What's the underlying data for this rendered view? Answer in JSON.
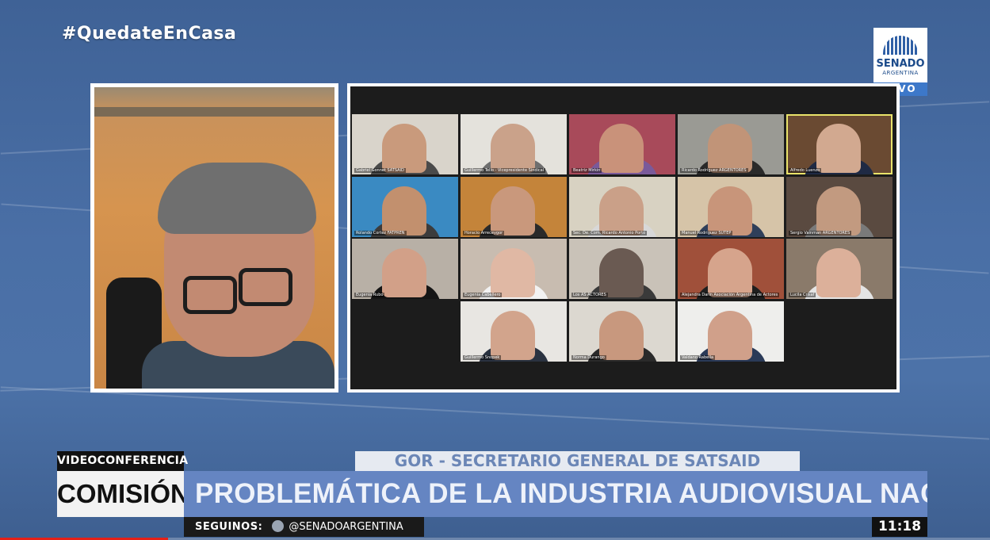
{
  "hashtag": "#QuedateEnCasa",
  "logo": {
    "name": "SENADO",
    "country": "ARGENTINA",
    "live": "VIVO"
  },
  "speaker": {
    "label": "active speaker video"
  },
  "gallery": {
    "participants": [
      {
        "name": "Gabriel Gonnet SATSAID",
        "skin": "#c99a7c",
        "bg": "#d9d4cb",
        "shirt": "#4a4a4a",
        "active": false
      },
      {
        "name": "Guillermo Tello - Vicepresidente Sindical",
        "skin": "#caa28a",
        "bg": "#e4e2dc",
        "shirt": "#6e6e6e",
        "active": false
      },
      {
        "name": "Beatriz Mirkin",
        "skin": "#c9927a",
        "bg": "#a84a5a",
        "shirt": "#7a5a9a",
        "active": false
      },
      {
        "name": "Ricardo Rodríguez ARGENTORES",
        "skin": "#c19478",
        "bg": "#9a9a94",
        "shirt": "#2a2a2a",
        "active": false
      },
      {
        "name": "Alfredo Luenzo",
        "skin": "#d2a990",
        "bg": "#6a4a32",
        "shirt": "#1f2a44",
        "active": true
      },
      {
        "name": "Rolando Cortez FATPREN",
        "skin": "#c2906e",
        "bg": "#3a8ac2",
        "shirt": "#3c3c3c",
        "active": false
      },
      {
        "name": "Horacio Arreceygor",
        "skin": "#c9987c",
        "bg": "#c4843a",
        "shirt": "#2a2a2a",
        "active": false
      },
      {
        "name": "Sec. De. Com. Ricardo Antonio Porto",
        "skin": "#caa088",
        "bg": "#d8d2c2",
        "shirt": "#d8d8d8",
        "active": false
      },
      {
        "name": "Manuel Rodríguez SUTEP",
        "skin": "#c8957a",
        "bg": "#d6c4a8",
        "shirt": "#2f3f5a",
        "active": false
      },
      {
        "name": "Sergio Vainman ARGENTORES",
        "skin": "#c29a80",
        "bg": "#5a4a40",
        "shirt": "#7a7a7a",
        "active": false
      },
      {
        "name": "Eugenia Rubo",
        "skin": "#d2a088",
        "bg": "#b8b0a6",
        "shirt": "#151515",
        "active": false
      },
      {
        "name": "Eugenia Cabellero",
        "skin": "#e0b8a4",
        "bg": "#c8bcb0",
        "shirt": "#f2f2f2",
        "active": false
      },
      {
        "name": "Los AS ACTORES",
        "skin": "#6a5a52",
        "bg": "#c9c2b8",
        "shirt": "#3a3a3a",
        "active": false
      },
      {
        "name": "Alejandra Darín Asociación Argentina de Actores",
        "skin": "#d6a48c",
        "bg": "#a0503a",
        "shirt": "#1f1f1f",
        "active": false
      },
      {
        "name": "Lucila Crisaf",
        "skin": "#dcb09a",
        "bg": "#8a7a6a",
        "shirt": "#e4e4e4",
        "active": false
      },
      {
        "name": "Guillermo Snopek",
        "skin": "#d2a48c",
        "bg": "#e8e6e2",
        "shirt": "#2a3240",
        "active": false
      },
      {
        "name": "Norma Durango",
        "skin": "#c8987e",
        "bg": "#dcd8d0",
        "shirt": "#2a2a2a",
        "active": false
      },
      {
        "name": "Valdano Rabella",
        "skin": "#d0a08a",
        "bg": "#eeeeec",
        "shirt": "#2a3a58",
        "active": false
      }
    ]
  },
  "lower_third": {
    "tag": "VIDEOCONFERENCIA",
    "section": "COMISIÓN",
    "subtitle": "GOR - SECRETARIO GENERAL DE SATSAID",
    "title": "PROBLEMÁTICA DE LA INDUSTRIA AUDIOVISUAL NACIONAL",
    "follow_label": "SEGUINOS:",
    "handle": "@SENADOARGENTINA",
    "clock": "11:18"
  },
  "player": {
    "progress": 0.17,
    "progress_color": "#e62117"
  }
}
